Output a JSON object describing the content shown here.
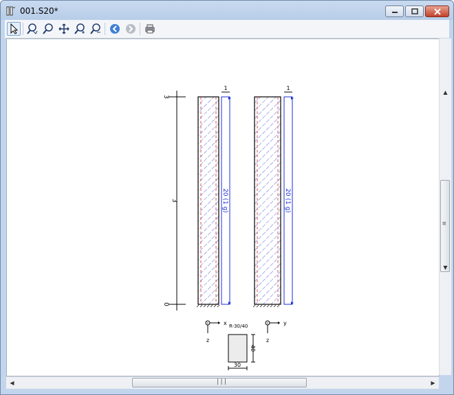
{
  "window": {
    "title": "001.S20*"
  },
  "toolbar": {
    "tools": [
      {
        "name": "pointer-tool-button",
        "icon": "cursor-arrow-icon"
      },
      {
        "name": "zoom-area-button",
        "icon": "zoom-area-icon"
      },
      {
        "name": "zoom-button",
        "icon": "magnifier-icon"
      },
      {
        "name": "pan-button",
        "icon": "move-arrows-icon"
      },
      {
        "name": "zoom-in-button",
        "icon": "zoom-in-icon"
      },
      {
        "name": "zoom-out-button",
        "icon": "zoom-out-icon"
      },
      {
        "name": "back-button",
        "icon": "back-arrow-icon"
      },
      {
        "name": "forward-button",
        "icon": "forward-arrow-icon"
      },
      {
        "name": "print-button",
        "icon": "printer-icon"
      }
    ]
  },
  "drawing": {
    "axis_top_label": "3",
    "axis_mid_label": "3",
    "axis_bottom_label": "0",
    "load1_top": "1",
    "load1_label": "20 (1 g)",
    "load2_top": "1",
    "load2_label": "20 (1 g)",
    "section_name": "R-30/40",
    "axis_x": "x",
    "axis_z1": "z",
    "axis_y": "y",
    "axis_z2": "z",
    "dim_height": "40",
    "dim_width": "30"
  },
  "colors": {
    "hatch": "#2b3fd0",
    "load": "#1b2cd6",
    "column_line": "#cc2a2a"
  }
}
